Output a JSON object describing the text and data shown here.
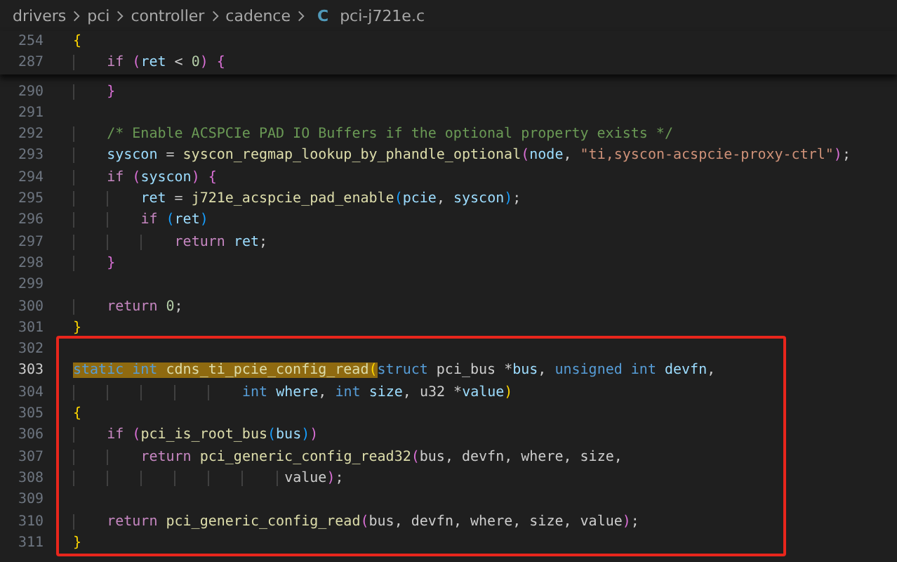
{
  "breadcrumb": {
    "segments": [
      "drivers",
      "pci",
      "controller",
      "cadence"
    ],
    "file_icon": "C",
    "file_name": "pci-j721e.c"
  },
  "editor": {
    "sticky_lines": [
      {
        "number": "254",
        "current": false,
        "tokens": [
          {
            "kind": "b1",
            "text": "{"
          }
        ]
      },
      {
        "number": "287",
        "current": false,
        "tokens": [
          {
            "kind": "kw",
            "text": "    if "
          },
          {
            "kind": "b2",
            "text": "("
          },
          {
            "kind": "var",
            "text": "ret"
          },
          {
            "kind": "p",
            "text": " < "
          },
          {
            "kind": "num",
            "text": "0"
          },
          {
            "kind": "b2",
            "text": ") {"
          }
        ]
      }
    ],
    "lines": [
      {
        "number": "290",
        "current": false,
        "tokens": [
          {
            "kind": "b2",
            "text": "    }"
          }
        ]
      },
      {
        "number": "291",
        "current": false
      },
      {
        "number": "292",
        "current": false,
        "tokens": [
          {
            "kind": "com",
            "text": "    /* Enable ACSPCIe PAD IO Buffers if the optional property exists */"
          }
        ]
      },
      {
        "number": "293",
        "current": false,
        "tokens": [
          {
            "kind": "var",
            "text": "    syscon"
          },
          {
            "kind": "p",
            "text": " = "
          },
          {
            "kind": "fn",
            "text": "syscon_regmap_lookup_by_phandle_optional"
          },
          {
            "kind": "b2",
            "text": "("
          },
          {
            "kind": "var",
            "text": "node"
          },
          {
            "kind": "p",
            "text": ", "
          },
          {
            "kind": "str",
            "text": "\"ti,syscon-acspcie-proxy-ctrl\""
          },
          {
            "kind": "b2",
            "text": ")"
          },
          {
            "kind": "p",
            "text": ";"
          }
        ]
      },
      {
        "number": "294",
        "current": false,
        "tokens": [
          {
            "kind": "kw",
            "text": "    if "
          },
          {
            "kind": "b2",
            "text": "("
          },
          {
            "kind": "var",
            "text": "syscon"
          },
          {
            "kind": "b2",
            "text": ") {"
          }
        ]
      },
      {
        "number": "295",
        "current": false,
        "tokens": [
          {
            "kind": "var",
            "text": "        ret"
          },
          {
            "kind": "p",
            "text": " = "
          },
          {
            "kind": "fn",
            "text": "j721e_acspcie_pad_enable"
          },
          {
            "kind": "b3",
            "text": "("
          },
          {
            "kind": "var",
            "text": "pcie"
          },
          {
            "kind": "p",
            "text": ", "
          },
          {
            "kind": "var",
            "text": "syscon"
          },
          {
            "kind": "b3",
            "text": ")"
          },
          {
            "kind": "p",
            "text": ";"
          }
        ]
      },
      {
        "number": "296",
        "current": false,
        "tokens": [
          {
            "kind": "kw",
            "text": "        if "
          },
          {
            "kind": "b3",
            "text": "("
          },
          {
            "kind": "var",
            "text": "ret"
          },
          {
            "kind": "b3",
            "text": ")"
          }
        ]
      },
      {
        "number": "297",
        "current": false,
        "tokens": [
          {
            "kind": "kw",
            "text": "            return "
          },
          {
            "kind": "var",
            "text": "ret"
          },
          {
            "kind": "p",
            "text": ";"
          }
        ]
      },
      {
        "number": "298",
        "current": false,
        "tokens": [
          {
            "kind": "b2",
            "text": "    }"
          }
        ]
      },
      {
        "number": "299",
        "current": false
      },
      {
        "number": "300",
        "current": false,
        "tokens": [
          {
            "kind": "kw",
            "text": "    return "
          },
          {
            "kind": "num",
            "text": "0"
          },
          {
            "kind": "p",
            "text": ";"
          }
        ]
      },
      {
        "number": "301",
        "current": false,
        "tokens": [
          {
            "kind": "b1",
            "text": "}"
          }
        ]
      }
    ],
    "highlight_box": {
      "lines": [
        {
          "number": "302",
          "current": false
        },
        {
          "number": "303",
          "current": true,
          "tokens": [
            {
              "kind": "st",
              "text": "static int ",
              "highlighted": true
            },
            {
              "kind": "fn",
              "text": "cdns_ti_pcie_config_read",
              "highlighted": true
            },
            {
              "kind": "b1",
              "text": "(",
              "highlighted": true
            },
            {
              "kind": "st",
              "text": "struct"
            },
            {
              "kind": "p",
              "text": " pci_bus *"
            },
            {
              "kind": "var",
              "text": "bus"
            },
            {
              "kind": "p",
              "text": ", "
            },
            {
              "kind": "st",
              "text": "unsigned int "
            },
            {
              "kind": "var",
              "text": "devfn"
            },
            {
              "kind": "p",
              "text": ","
            }
          ]
        },
        {
          "number": "304",
          "current": false,
          "tokens": [
            {
              "kind": "st",
              "text": "                    int "
            },
            {
              "kind": "var",
              "text": "where"
            },
            {
              "kind": "p",
              "text": ", "
            },
            {
              "kind": "st",
              "text": "int "
            },
            {
              "kind": "var",
              "text": "size"
            },
            {
              "kind": "p",
              "text": ", u32 *"
            },
            {
              "kind": "var",
              "text": "value"
            },
            {
              "kind": "b1",
              "text": ")"
            }
          ]
        },
        {
          "number": "305",
          "current": false,
          "tokens": [
            {
              "kind": "b1",
              "text": "{"
            }
          ]
        },
        {
          "number": "306",
          "current": false,
          "tokens": [
            {
              "kind": "kw",
              "text": "    if "
            },
            {
              "kind": "b2",
              "text": "("
            },
            {
              "kind": "fn",
              "text": "pci_is_root_bus"
            },
            {
              "kind": "b3",
              "text": "("
            },
            {
              "kind": "var",
              "text": "bus"
            },
            {
              "kind": "b3",
              "text": ")"
            },
            {
              "kind": "b2",
              "text": ")"
            }
          ]
        },
        {
          "number": "307",
          "current": false,
          "tokens": [
            {
              "kind": "kw",
              "text": "        return "
            },
            {
              "kind": "fn",
              "text": "pci_generic_config_read32"
            },
            {
              "kind": "b2",
              "text": "("
            },
            {
              "kind": "p",
              "text": "bus, devfn, where, size,"
            }
          ]
        },
        {
          "number": "308",
          "current": false,
          "tokens": [
            {
              "kind": "p",
              "text": "                         value"
            },
            {
              "kind": "b2",
              "text": ")"
            },
            {
              "kind": "p",
              "text": ";"
            }
          ]
        },
        {
          "number": "309",
          "current": false
        },
        {
          "number": "310",
          "current": false,
          "tokens": [
            {
              "kind": "kw",
              "text": "    return "
            },
            {
              "kind": "fn",
              "text": "pci_generic_config_read"
            },
            {
              "kind": "b2",
              "text": "("
            },
            {
              "kind": "p",
              "text": "bus, devfn, where, size, value"
            },
            {
              "kind": "b2",
              "text": ")"
            },
            {
              "kind": "p",
              "text": ";"
            }
          ]
        },
        {
          "number": "311",
          "current": false,
          "tokens": [
            {
              "kind": "b1",
              "text": "}"
            }
          ]
        }
      ]
    }
  }
}
